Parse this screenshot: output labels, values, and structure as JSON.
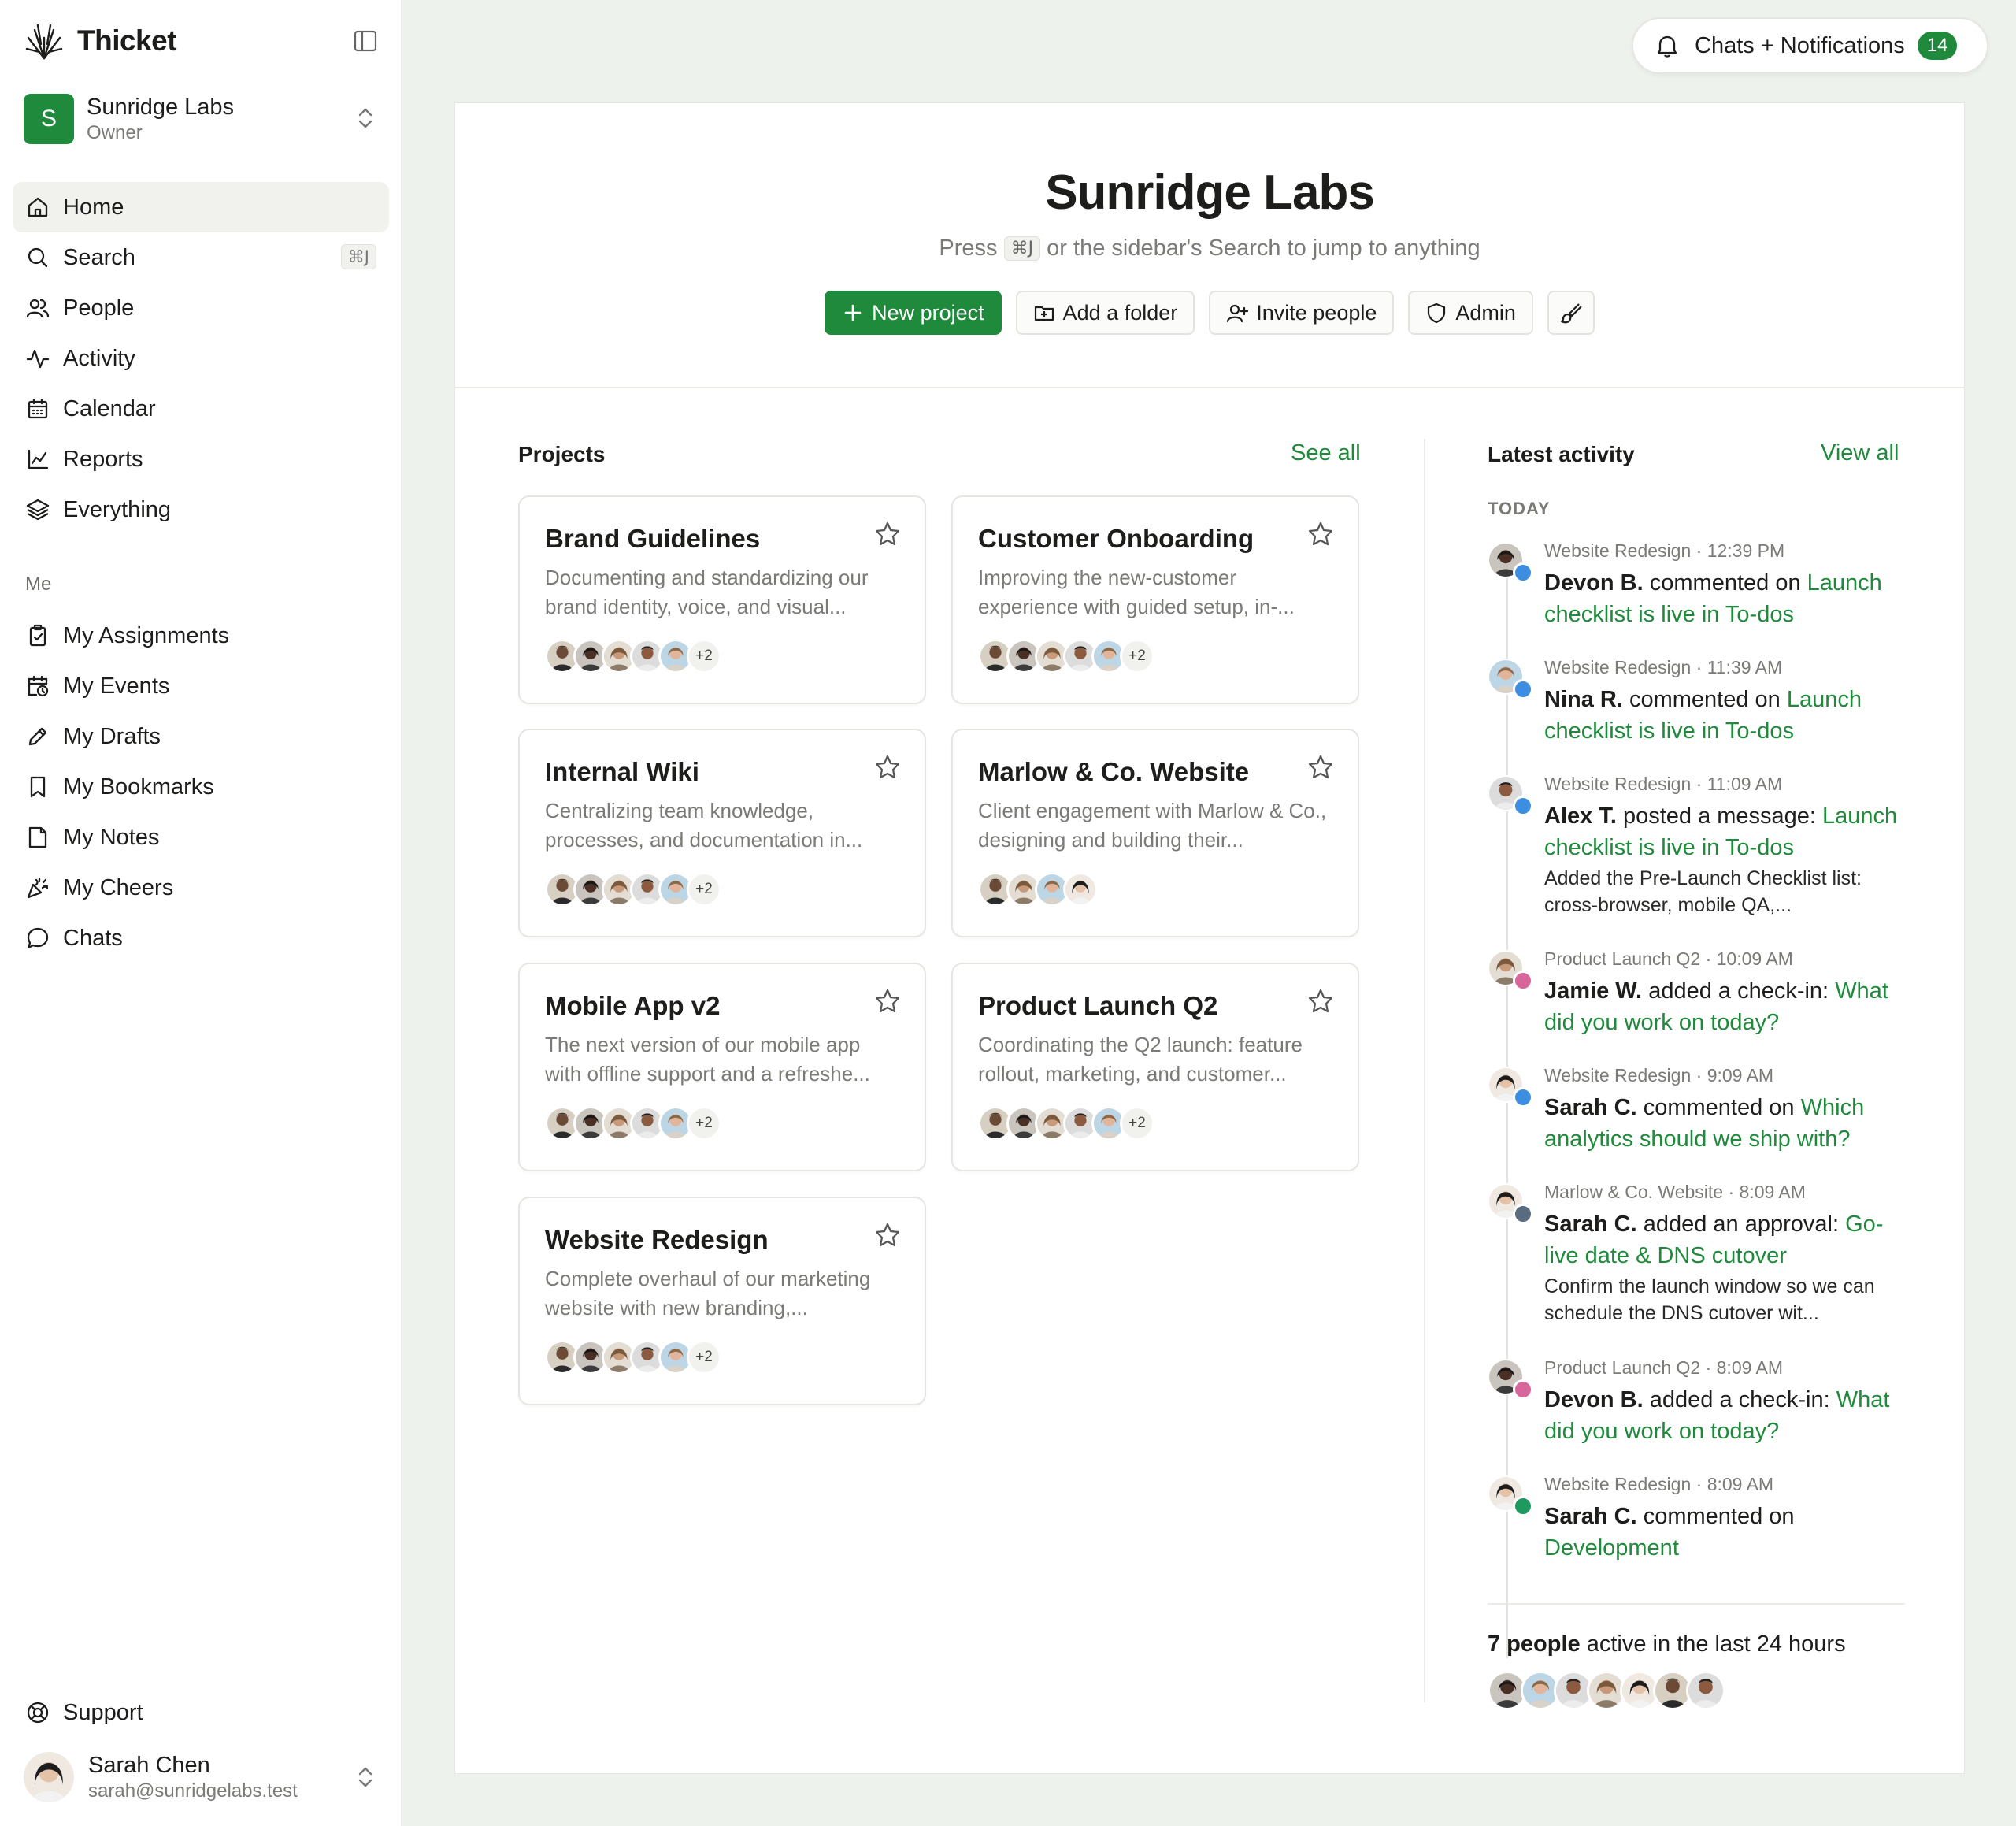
{
  "brand": {
    "name": "Thicket"
  },
  "org": {
    "initial": "S",
    "name": "Sunridge Labs",
    "role": "Owner"
  },
  "nav": [
    {
      "label": "Home",
      "icon": "home-icon"
    },
    {
      "label": "Search",
      "icon": "search-icon",
      "shortcut": "⌘J"
    },
    {
      "label": "People",
      "icon": "people-icon"
    },
    {
      "label": "Activity",
      "icon": "activity-icon"
    },
    {
      "label": "Calendar",
      "icon": "calendar-icon"
    },
    {
      "label": "Reports",
      "icon": "chart-icon"
    },
    {
      "label": "Everything",
      "icon": "layers-icon"
    }
  ],
  "me_section": "Me",
  "me_nav": [
    {
      "label": "My Assignments",
      "icon": "clipboard-check-icon"
    },
    {
      "label": "My Events",
      "icon": "calendar-clock-icon"
    },
    {
      "label": "My Drafts",
      "icon": "pencil-icon"
    },
    {
      "label": "My Bookmarks",
      "icon": "bookmark-icon"
    },
    {
      "label": "My Notes",
      "icon": "note-icon"
    },
    {
      "label": "My Cheers",
      "icon": "party-icon"
    },
    {
      "label": "Chats",
      "icon": "chat-bubble-icon"
    }
  ],
  "support": {
    "label": "Support",
    "icon": "lifebuoy-icon"
  },
  "user": {
    "name": "Sarah Chen",
    "email": "sarah@sunridgelabs.test"
  },
  "notifications": {
    "label": "Chats + Notifications",
    "count": "14"
  },
  "hero": {
    "title": "Sunridge Labs",
    "sub_prefix": "Press",
    "sub_kbd": "⌘J",
    "sub_suffix": "or the sidebar's Search to jump to anything",
    "new_project": "New project",
    "add_folder": "Add a folder",
    "invite": "Invite people",
    "admin": "Admin"
  },
  "projects": {
    "title": "Projects",
    "see_all": "See all",
    "items": [
      {
        "title": "Brand Guidelines",
        "desc": "Documenting and standardizing our brand identity, voice, and visual...",
        "more": "+2"
      },
      {
        "title": "Customer Onboarding",
        "desc": "Improving the new-customer experience with guided setup, in-...",
        "more": "+2"
      },
      {
        "title": "Internal Wiki",
        "desc": "Centralizing team knowledge, processes, and documentation in...",
        "more": "+2"
      },
      {
        "title": "Marlow & Co. Website",
        "desc": "Client engagement with Marlow & Co., designing and building their...",
        "more": ""
      },
      {
        "title": "Mobile App v2",
        "desc": "The next version of our mobile app with offline support and a refreshe...",
        "more": "+2"
      },
      {
        "title": "Product Launch Q2",
        "desc": "Coordinating the Q2 launch: feature rollout, marketing, and customer...",
        "more": "+2"
      },
      {
        "title": "Website Redesign",
        "desc": "Complete overhaul of our marketing website with new branding,...",
        "more": "+2"
      }
    ]
  },
  "activity": {
    "title": "Latest activity",
    "view_all": "View all",
    "today": "TODAY",
    "items": [
      {
        "project": "Website Redesign",
        "time": "12:39 PM",
        "actor": "Devon B.",
        "verb": "commented on",
        "target": "Launch checklist is live in To-dos",
        "excerpt": ""
      },
      {
        "project": "Website Redesign",
        "time": "11:39 AM",
        "actor": "Nina R.",
        "verb": "commented on",
        "target": "Launch checklist is live in To-dos",
        "excerpt": ""
      },
      {
        "project": "Website Redesign",
        "time": "11:09 AM",
        "actor": "Alex T.",
        "verb": "posted a message:",
        "target": "Launch checklist is live in To-dos",
        "excerpt": "Added the Pre-Launch Checklist list: cross-browser, mobile QA,..."
      },
      {
        "project": "Product Launch Q2",
        "time": "10:09 AM",
        "actor": "Jamie W.",
        "verb": "added a check-in:",
        "target": "What did you work on today?",
        "excerpt": ""
      },
      {
        "project": "Website Redesign",
        "time": "9:09 AM",
        "actor": "Sarah C.",
        "verb": "commented on",
        "target": "Which analytics should we ship with?",
        "excerpt": ""
      },
      {
        "project": "Marlow & Co. Website",
        "time": "8:09 AM",
        "actor": "Sarah C.",
        "verb": "added an approval:",
        "target": "Go-live date & DNS cutover",
        "excerpt": "Confirm the launch window so we can schedule the DNS cutover wit..."
      },
      {
        "project": "Product Launch Q2",
        "time": "8:09 AM",
        "actor": "Devon B.",
        "verb": "added a check-in:",
        "target": "What did you work on today?",
        "excerpt": ""
      },
      {
        "project": "Website Redesign",
        "time": "8:09 AM",
        "actor": "Sarah C.",
        "verb": "commented on",
        "target": "Development",
        "excerpt": ""
      }
    ],
    "footer_count": "7 people",
    "footer_text": "active in the last 24 hours"
  },
  "colors": {
    "accent": "#1f8a3b",
    "sidebar_bg": "#ffffff",
    "page_bg": "#eef2ec"
  }
}
